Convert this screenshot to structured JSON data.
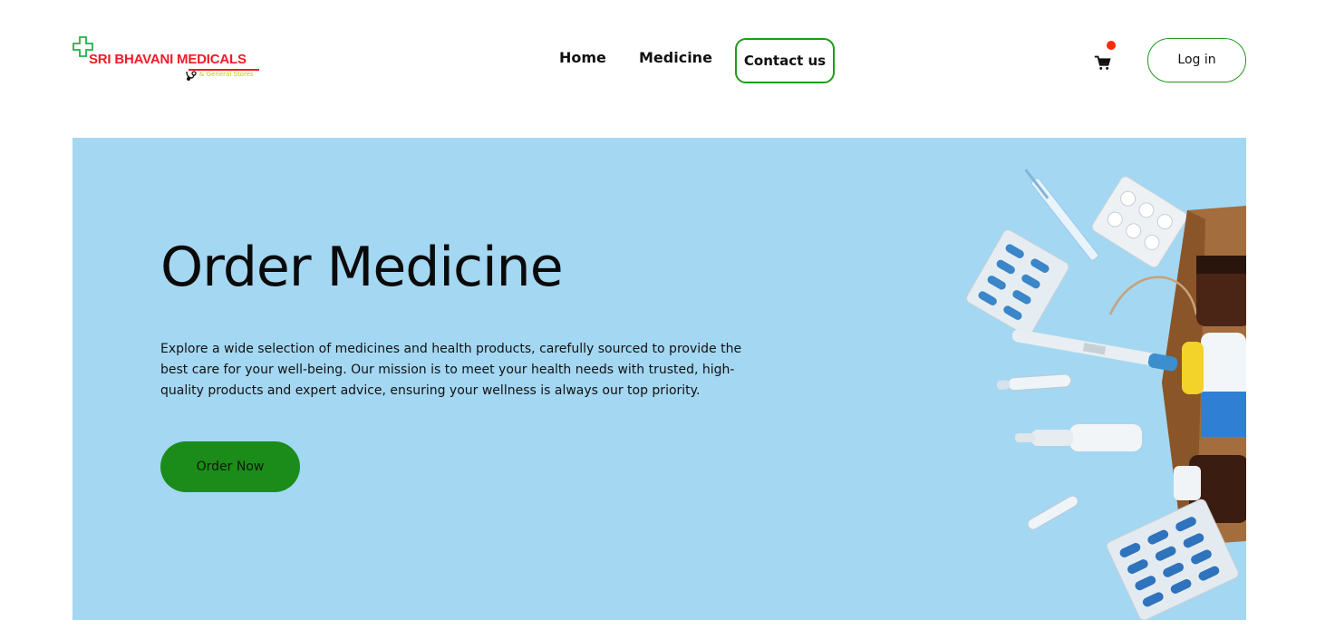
{
  "brand": {
    "name": "SRI BHAVANI MEDICALS",
    "tagline": "& General Stores",
    "colors": {
      "red": "#ee1c25",
      "green": "#22b14c",
      "lime": "#b6d300"
    }
  },
  "nav": {
    "home": "Home",
    "medicine": "Medicine",
    "contact": "Contact us"
  },
  "header": {
    "cart_icon": "shopping-cart-icon",
    "login_label": "Log in"
  },
  "hero": {
    "title": "Order Medicine",
    "description": "Explore a wide selection of medicines and health products, carefully sourced to provide the best care for your well-being. Our mission is to meet your health needs with trusted, high-quality products and expert advice, ensuring your wellness is always our top priority.",
    "cta_label": "Order Now",
    "background": "#a4d7f2",
    "cta_color": "#1b8c1a"
  }
}
